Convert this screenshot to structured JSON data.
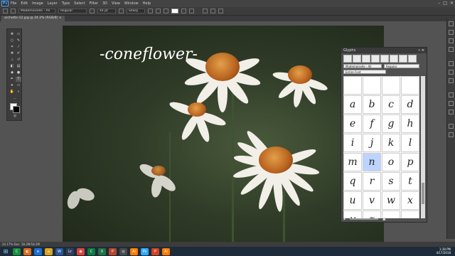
{
  "app": {
    "logo": "Ps"
  },
  "menu": [
    "File",
    "Edit",
    "Image",
    "Layer",
    "Type",
    "Select",
    "Filter",
    "3D",
    "View",
    "Window",
    "Help"
  ],
  "window_controls": [
    "–",
    "□",
    "✕"
  ],
  "options_bar": {
    "font_family": "Mademoiselle - All",
    "font_style": "Regular",
    "font_size": "44 pt",
    "aa_method": "Sharp"
  },
  "document_tab": "archetto-12.jpg @ 24.2% (RGB/8) ×",
  "artwork_text": "-coneflower-",
  "glyphs_panel": {
    "title": "Glyphs",
    "close": "»  ≡",
    "font_family": "Mademoiselle - All",
    "font_style": "Regular",
    "show": "Entire Font",
    "glyphs": [
      "",
      "",
      "",
      "",
      "a",
      "b",
      "c",
      "d",
      "e",
      "f",
      "g",
      "h",
      "i",
      "j",
      "k",
      "l",
      "m",
      "n",
      "o",
      "p",
      "q",
      "r",
      "s",
      "t",
      "u",
      "v",
      "w",
      "x",
      "y",
      "z",
      "",
      ""
    ],
    "selected_index": 17
  },
  "status_bar": "24.17%    Doc: 18.2M/18.2M",
  "taskbar": {
    "apps": [
      {
        "label": "C",
        "color": "#1a8f3c"
      },
      {
        "label": "◐",
        "color": "#e06c1c"
      },
      {
        "label": "e",
        "color": "#1f6fd1"
      },
      {
        "label": "⌂",
        "color": "#d9a521"
      },
      {
        "label": "W",
        "color": "#2b579a"
      },
      {
        "label": "Lr",
        "color": "#2f3f5c"
      },
      {
        "label": "◉",
        "color": "#db4437"
      },
      {
        "label": "C",
        "color": "#117a3c"
      },
      {
        "label": "X",
        "color": "#217346"
      },
      {
        "label": "P",
        "color": "#b7472a"
      },
      {
        "label": "◎",
        "color": "#4a4a4a"
      },
      {
        "label": "Ai",
        "color": "#ff7c00"
      },
      {
        "label": "Ps",
        "color": "#31a8ff"
      },
      {
        "label": "P",
        "color": "#d04423"
      },
      {
        "label": "Ai",
        "color": "#ff7c00"
      }
    ],
    "time": "1:38 PM",
    "date": "4/17/2018"
  }
}
